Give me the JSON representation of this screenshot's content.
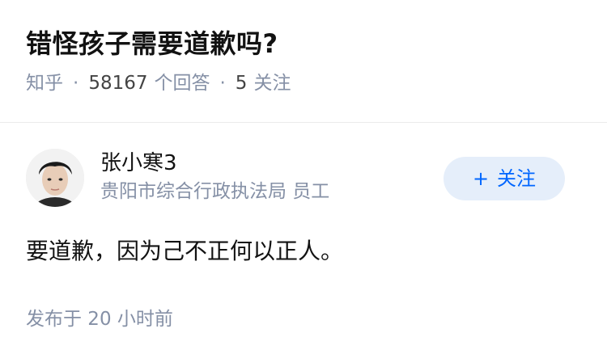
{
  "question": {
    "title": "错怪孩子需要道歉吗?",
    "source": "知乎",
    "answer_count": "58167",
    "answer_label": "个回答",
    "follower_count": "5",
    "follower_label": "关注"
  },
  "answer": {
    "author": {
      "name": "张小寒3",
      "headline": "贵阳市综合行政执法局 员工"
    },
    "follow_button": {
      "icon": "+",
      "label": "关注"
    },
    "content": "要道歉，因为己不正何以正人。",
    "time": "发布于  20 小时前"
  },
  "colors": {
    "title": "#121212",
    "meta": "#8590a6",
    "follow_bg": "#e5eefa",
    "follow_text": "#0066ff",
    "divider": "#ebebeb"
  }
}
